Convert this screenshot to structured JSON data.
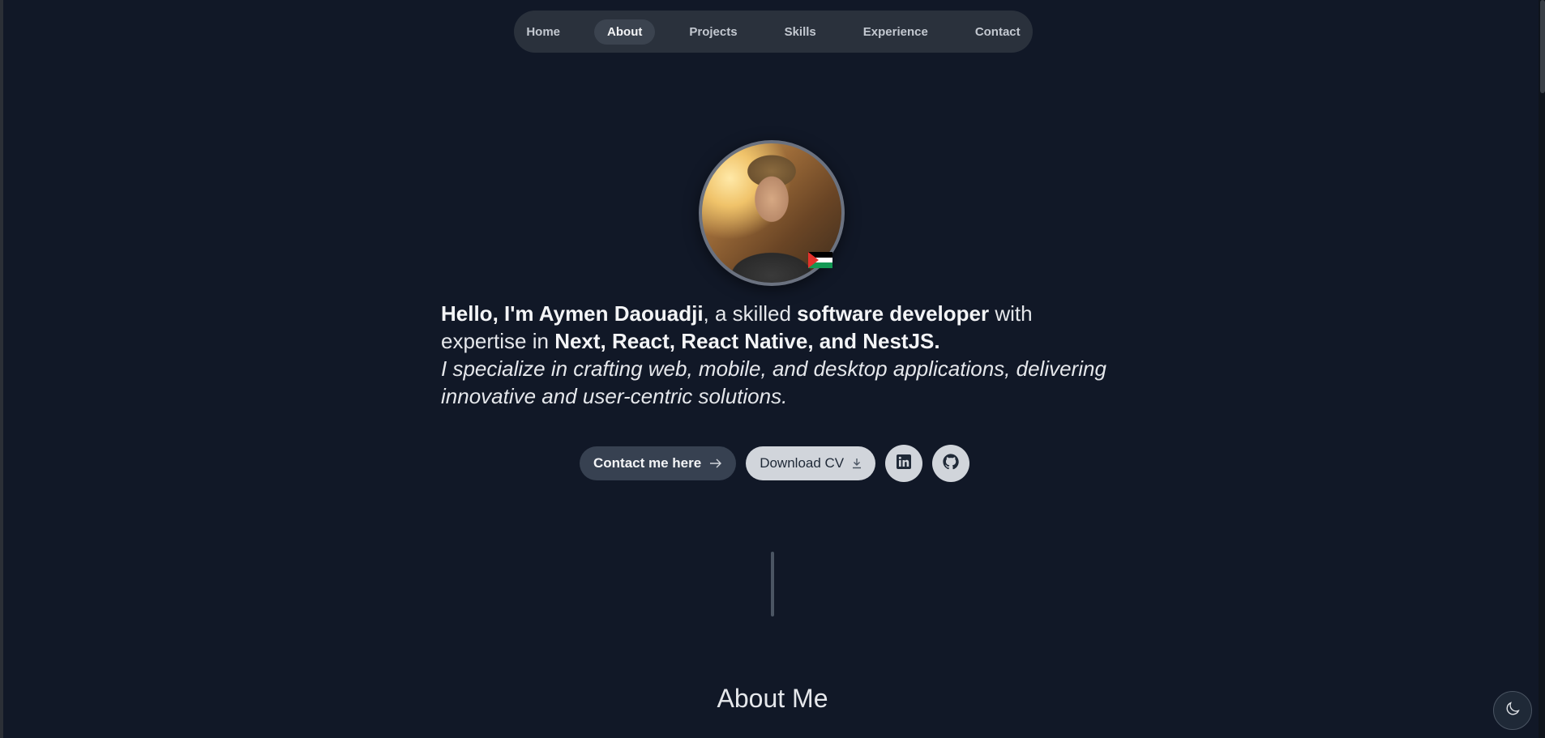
{
  "nav": {
    "items": [
      {
        "label": "Home"
      },
      {
        "label": "About"
      },
      {
        "label": "Projects"
      },
      {
        "label": "Skills"
      },
      {
        "label": "Experience"
      },
      {
        "label": "Contact"
      }
    ],
    "active": "About"
  },
  "hero": {
    "greeting": "Hello, I'm Aymen Daouadji",
    "text_a": ", a skilled ",
    "role": "software developer",
    "text_b": " with expertise in ",
    "stack": "Next, React, React Native, and NestJS.",
    "tagline": "I specialize in crafting web, mobile, and desktop applications, delivering innovative and user-centric solutions."
  },
  "actions": {
    "contact_label": "Contact me here",
    "cv_label": "Download CV"
  },
  "icons": {
    "contact": "arrow-right-icon",
    "cv": "download-icon",
    "linkedin": "linkedin-icon",
    "github": "github-icon",
    "theme": "moon-icon"
  },
  "sections": {
    "about_title": "About Me"
  },
  "colors": {
    "background": "#111827",
    "nav_bg": "#2a313c",
    "nav_active": "#3b434f",
    "button_dark": "#374151",
    "button_light": "#d1d5db"
  }
}
